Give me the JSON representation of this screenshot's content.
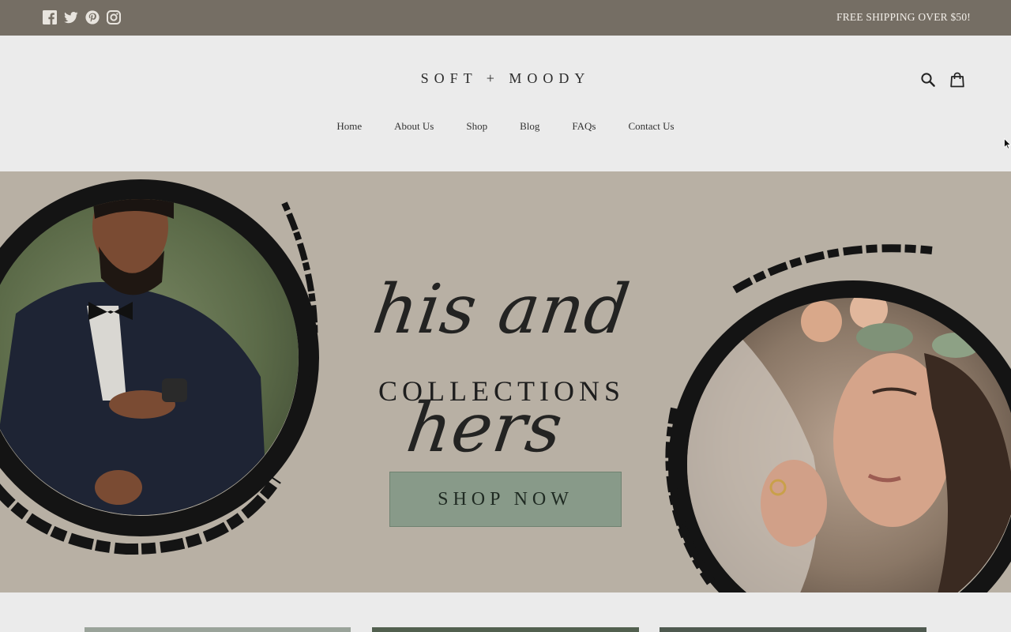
{
  "announcement": {
    "text": "FREE SHIPPING OVER $50!",
    "social": [
      "facebook-icon",
      "twitter-icon",
      "pinterest-icon",
      "instagram-icon"
    ]
  },
  "header": {
    "logo": "SOFT + MOODY",
    "icons": [
      "search-icon",
      "cart-icon"
    ]
  },
  "nav": {
    "items": [
      {
        "label": "Home"
      },
      {
        "label": "About Us"
      },
      {
        "label": "Shop"
      },
      {
        "label": "Blog"
      },
      {
        "label": "FAQs"
      },
      {
        "label": "Contact Us"
      }
    ]
  },
  "hero": {
    "script_text": "his and hers",
    "subtitle": "COLLECTIONS",
    "cta": "SHOP NOW"
  },
  "colors": {
    "topbar": "#756e64",
    "header_bg": "#ebebeb",
    "hero_bg": "#b8b0a4",
    "cta_bg": "#889a89"
  }
}
